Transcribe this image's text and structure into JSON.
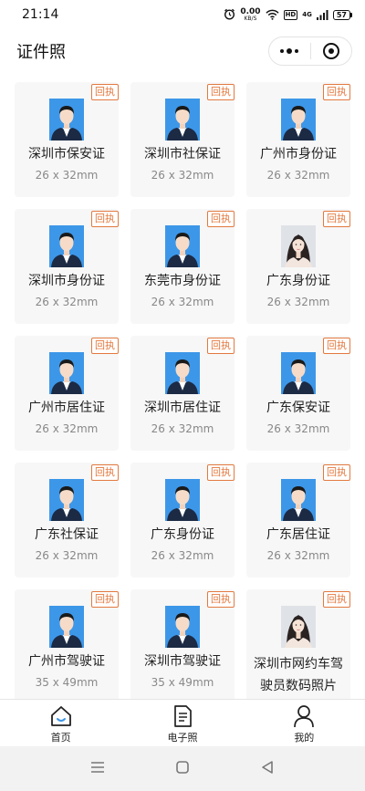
{
  "status": {
    "time": "21:14",
    "net_speed_value": "0.00",
    "net_speed_unit": "KB/S",
    "hd_label": "HD",
    "signal_label": "4G",
    "battery": "57",
    "icons": [
      "alarm-icon",
      "wifi-icon",
      "signal-icon",
      "battery-icon"
    ]
  },
  "header": {
    "title": "证件照"
  },
  "badge_label": "回执",
  "colors": {
    "badge": "#e3793f",
    "photo_bg": "#3d97e8",
    "card_bg": "#f7f7f7"
  },
  "items": [
    {
      "name": "深圳市保安证",
      "size": "26 x 32mm",
      "photo": "avatar"
    },
    {
      "name": "深圳市社保证",
      "size": "26 x 32mm",
      "photo": "avatar"
    },
    {
      "name": "广州市身份证",
      "size": "26 x 32mm",
      "photo": "avatar"
    },
    {
      "name": "深圳市身份证",
      "size": "26 x 32mm",
      "photo": "avatar"
    },
    {
      "name": "东莞市身份证",
      "size": "26 x 32mm",
      "photo": "avatar"
    },
    {
      "name": "广东身份证",
      "size": "26 x 32mm",
      "photo": "portrait"
    },
    {
      "name": "广州市居住证",
      "size": "26 x 32mm",
      "photo": "avatar"
    },
    {
      "name": "深圳市居住证",
      "size": "26 x 32mm",
      "photo": "avatar"
    },
    {
      "name": "广东保安证",
      "size": "26 x 32mm",
      "photo": "avatar"
    },
    {
      "name": "广东社保证",
      "size": "26 x 32mm",
      "photo": "avatar"
    },
    {
      "name": "广东身份证",
      "size": "26 x 32mm",
      "photo": "avatar"
    },
    {
      "name": "广东居住证",
      "size": "26 x 32mm",
      "photo": "avatar"
    },
    {
      "name": "广州市驾驶证",
      "size": "35 x 49mm",
      "photo": "avatar"
    },
    {
      "name": "深圳市驾驶证",
      "size": "35 x 49mm",
      "photo": "avatar"
    },
    {
      "name": "深圳市网约车驾驶员数码照片",
      "size": "",
      "photo": "portrait"
    }
  ],
  "tabbar": {
    "tabs": [
      {
        "label": "首页",
        "icon": "home-icon"
      },
      {
        "label": "电子照",
        "icon": "document-icon"
      },
      {
        "label": "我的",
        "icon": "user-icon"
      }
    ]
  },
  "navbar": {
    "buttons": [
      "menu-icon",
      "home-square-icon",
      "back-triangle-icon"
    ]
  }
}
